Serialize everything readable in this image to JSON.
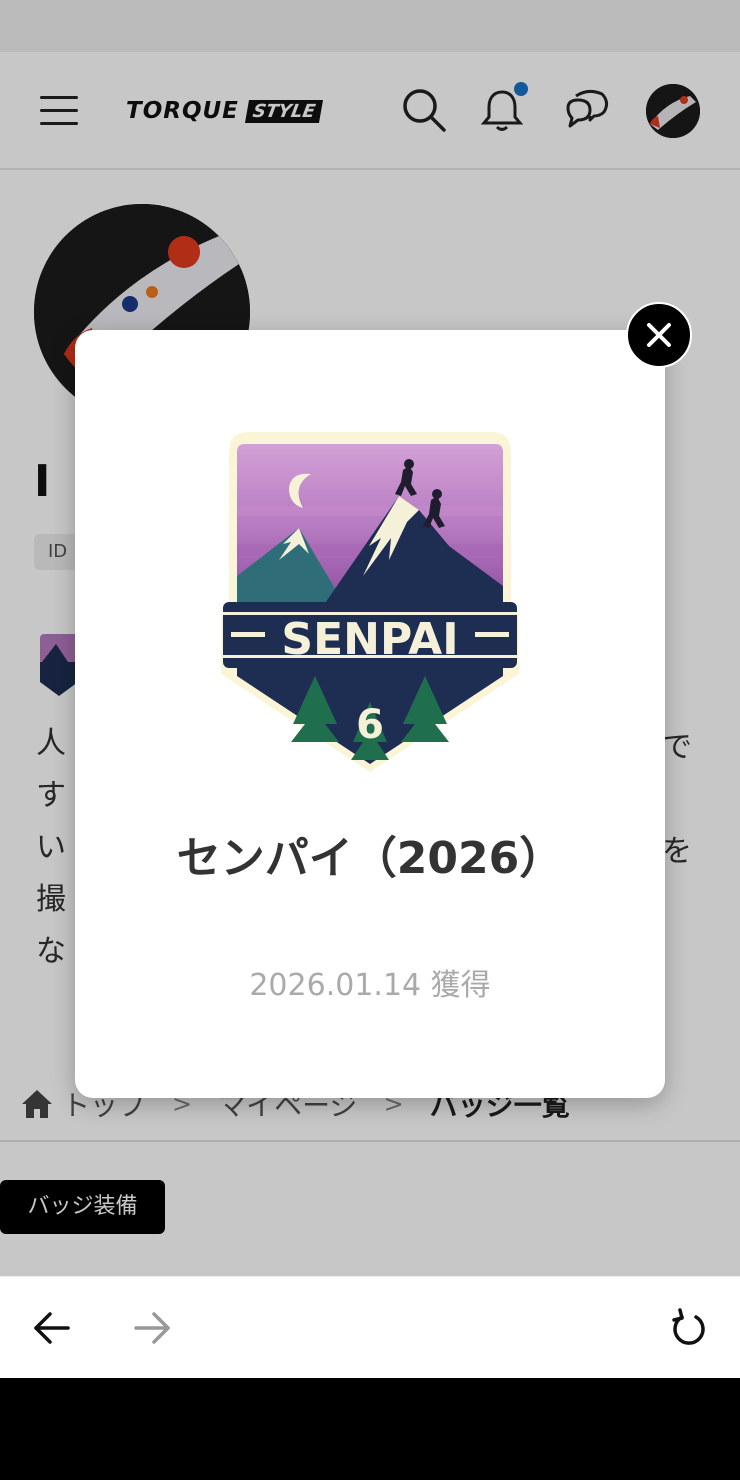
{
  "header": {
    "logo_main": "TORQUE",
    "logo_sub": "STYLE",
    "icons": [
      "menu-icon",
      "search-icon",
      "bell-icon",
      "chat-icon",
      "avatar"
    ],
    "notification_dot_color": "#1a73c8"
  },
  "profile": {
    "name_fragment": "I",
    "id_prefix": "ID",
    "bio_lines": [
      "人",
      "す",
      "い",
      "撮",
      "な"
    ],
    "bio_right_fragments": [
      "で",
      "を"
    ]
  },
  "breadcrumb": {
    "items": [
      "トップ",
      "マイページ",
      "バッジ一覧"
    ]
  },
  "equip_button": "バッジ装備",
  "modal": {
    "badge_text": "SENPAI",
    "badge_number": "6",
    "title": "センパイ（2026）",
    "acquired": "2026.01.14 獲得",
    "colors": {
      "sky_top": "#c98fcf",
      "sky_bottom": "#9a5aa8",
      "mountain": "#1e2d52",
      "snow": "#f5f0d8",
      "forest": "#1f6e4e",
      "frame": "#fbf5d7",
      "banner": "#1e2d52"
    }
  },
  "nav": {
    "back": "back-arrow-icon",
    "forward": "forward-arrow-icon",
    "reload": "reload-icon"
  }
}
